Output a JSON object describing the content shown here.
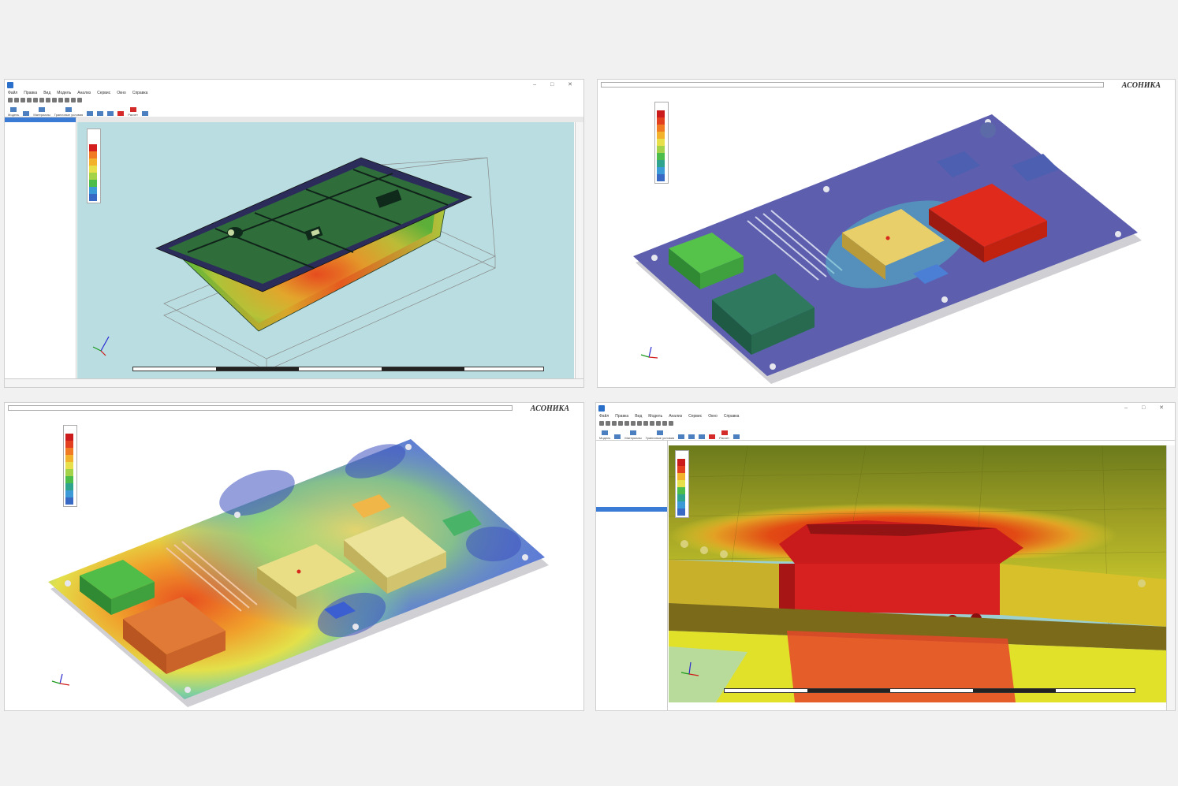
{
  "windows": {
    "p1": {
      "menu": [
        "Файл",
        "Правка",
        "Вид",
        "Модель",
        "Анализ",
        "Сервис",
        "Окно",
        "Справка"
      ],
      "ribbon": [
        "Модель",
        "",
        "Материалы",
        "Граничные условия",
        "",
        "",
        "",
        "",
        "Расчет",
        "",
        "",
        ""
      ],
      "tabs": [
        "",
        "",
        ""
      ],
      "tree": [
        "",
        "",
        "",
        "",
        "",
        "",
        "",
        "",
        ""
      ],
      "legend_title": "",
      "legend_ticks": [
        "",
        "",
        "",
        "",
        "",
        "",
        "",
        "",
        "",
        ""
      ],
      "scale_label": "",
      "status": ""
    },
    "p2": {
      "title": "",
      "legend_title": "",
      "legend_ticks": [
        "",
        "",
        "",
        "",
        "",
        "",
        "",
        "",
        "",
        "",
        ""
      ]
    },
    "p3": {
      "title": "",
      "legend_title": "",
      "legend_ticks": [
        "",
        "",
        "",
        "",
        "",
        "",
        "",
        "",
        "",
        "",
        ""
      ]
    },
    "p4": {
      "menu": [
        "Файл",
        "Правка",
        "Вид",
        "Модель",
        "Анализ",
        "Сервис",
        "Окно",
        "Справка"
      ],
      "ribbon": [
        "Модель",
        "",
        "Материалы",
        "Граничные условия",
        "",
        "",
        "",
        "",
        "Расчет",
        "",
        "",
        ""
      ],
      "tree": [
        "",
        "",
        "",
        "",
        "",
        "",
        "",
        "",
        "",
        "",
        "",
        "",
        "",
        "",
        ""
      ],
      "legend_title": "",
      "legend_ticks": [
        "",
        "",
        "",
        "",
        "",
        "",
        "",
        ""
      ],
      "scale_label": ""
    }
  },
  "brand_text": "АСОНИКА",
  "colors": {
    "viewport_bg_cyan": "#b9dde0",
    "board_blue": "#5d5fae",
    "hot_red": "#e02a1c",
    "warm_yellow": "#e9cf6a",
    "green": "#3bb34a",
    "dark_green": "#2e7a5a",
    "tree_selected": "#3a7bd5"
  },
  "legend_colors": [
    "#cc1b1b",
    "#e2401e",
    "#f07b22",
    "#f3b22c",
    "#e7e04a",
    "#a4d34a",
    "#4cbd4a",
    "#2ea38e",
    "#3c9ad6",
    "#3869c5",
    "#3b3fb0"
  ]
}
